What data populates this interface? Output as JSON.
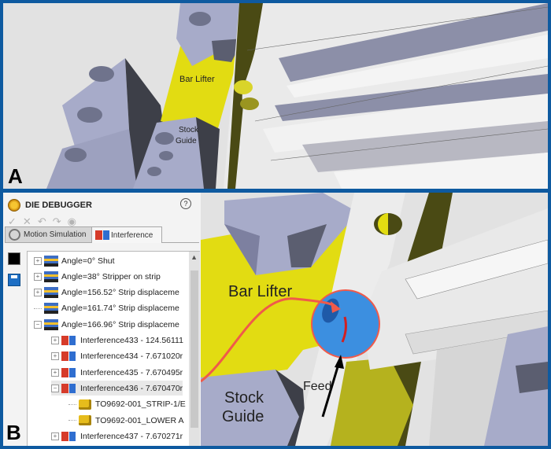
{
  "panels": {
    "a": {
      "letter": "A",
      "labels": {
        "bar_lifter": "Bar Lifter",
        "stock_guide_1": "Stock",
        "stock_guide_2": "Guide"
      }
    },
    "b": {
      "letter": "B",
      "labels": {
        "bar_lifter": "Bar Lifter",
        "stock_guide_1": "Stock",
        "stock_guide_2": "Guide",
        "feed": "Feed"
      }
    }
  },
  "debugger": {
    "title": "DIE DEBUGGER",
    "help_icon": "?",
    "toolbar": {
      "ok": "✓",
      "cancel": "✕",
      "undo": "↶",
      "redo": "↷",
      "view": "◉"
    },
    "tabs": [
      {
        "label": "Motion Simulation",
        "active": false
      },
      {
        "label": "Interference",
        "active": true
      }
    ],
    "tree": [
      {
        "label": "Angle=0° Shut",
        "icon": "angle-icon",
        "expander": "+",
        "indent": 0
      },
      {
        "label": "Angle=38° Stripper on strip",
        "icon": "angle-icon",
        "expander": "+",
        "indent": 0
      },
      {
        "label": "Angle=156.52° Strip displaceme",
        "icon": "angle-icon",
        "expander": "+",
        "indent": 0
      },
      {
        "label": "Angle=161.74° Strip displaceme",
        "icon": "angle-icon",
        "expander": "",
        "indent": 0
      },
      {
        "label": "Angle=166.96° Strip displaceme",
        "icon": "angle-icon",
        "expander": "−",
        "indent": 0
      },
      {
        "label": "Interference433 - 124.56111",
        "icon": "interference-icon",
        "expander": "+",
        "indent": 1
      },
      {
        "label": "Interference434 - 7.671020r",
        "icon": "interference-icon",
        "expander": "+",
        "indent": 1
      },
      {
        "label": "Interference435 - 7.670495r",
        "icon": "interference-icon",
        "expander": "+",
        "indent": 1
      },
      {
        "label": "Interference436 - 7.670470r",
        "icon": "interference-icon",
        "expander": "−",
        "indent": 1,
        "selected": true
      },
      {
        "label": "TO9692-001_STRIP-1/E",
        "icon": "part-icon",
        "expander": "",
        "indent": 2
      },
      {
        "label": "TO9692-001_LOWER A",
        "icon": "part-icon",
        "expander": "",
        "indent": 2
      },
      {
        "label": "Interference437 - 7.670271r",
        "icon": "interference-icon",
        "expander": "+",
        "indent": 1
      }
    ]
  },
  "colors": {
    "frame": "#0e5aa0",
    "bar_lifter": "#e2dc12",
    "highlight_circle": "#3c8fe0",
    "callout_line": "#f05a4a",
    "steel": "#a7abc9",
    "shadow": "#3d3f48"
  }
}
